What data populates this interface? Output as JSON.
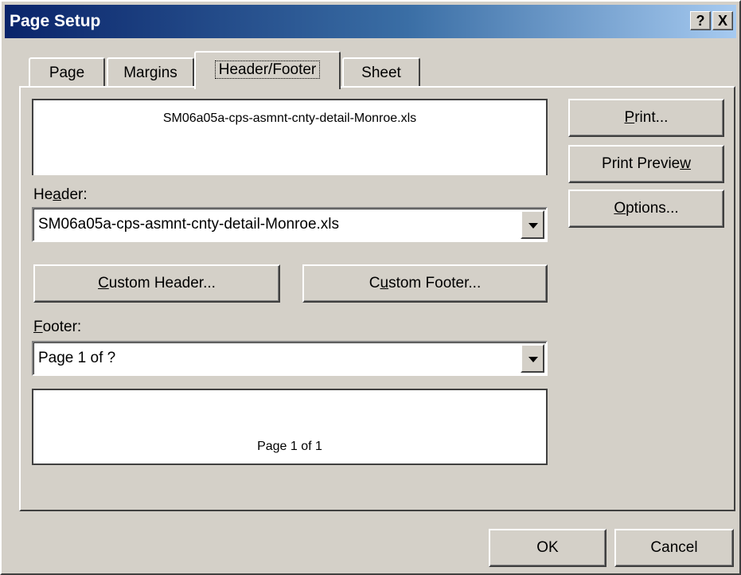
{
  "window": {
    "title": "Page Setup",
    "help_label": "?",
    "close_label": "X"
  },
  "tabs": [
    {
      "label": "Page"
    },
    {
      "label": "Margins"
    },
    {
      "label": "Header/Footer"
    },
    {
      "label": "Sheet"
    }
  ],
  "header_preview": {
    "text": "SM06a05a-cps-asmnt-cnty-detail-Monroe.xls"
  },
  "header": {
    "label_pre": "He",
    "label_key": "a",
    "label_post": "der:",
    "value": "SM06a05a-cps-asmnt-cnty-detail-Monroe.xls"
  },
  "buttons": {
    "custom_header": {
      "key": "C",
      "rest": "ustom Header..."
    },
    "custom_footer": {
      "pre": "C",
      "key": "u",
      "rest": "stom Footer..."
    },
    "print": {
      "key": "P",
      "rest": "rint..."
    },
    "print_preview": {
      "pre": "Print Previe",
      "key": "w",
      "rest": ""
    },
    "options": {
      "key": "O",
      "rest": "ptions..."
    },
    "ok": "OK",
    "cancel": "Cancel"
  },
  "footer": {
    "label_key": "F",
    "label_post": "ooter:",
    "value": "Page 1 of ?"
  },
  "footer_preview": {
    "text": "Page 1 of 1"
  }
}
